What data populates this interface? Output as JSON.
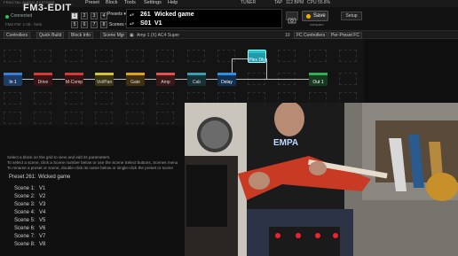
{
  "app": {
    "logo_small": "FRACTAL AUDIO SYSTEMS",
    "logo": "FM3-EDIT",
    "menu": [
      "Preset",
      "Block",
      "Tools",
      "Settings",
      "Help"
    ],
    "tuner": "TUNER",
    "tap": "TAP",
    "bpm": "112 BPM",
    "cpu": "CPU 55.8%"
  },
  "status": {
    "connected": "Connected",
    "firmware": "FM3 FW: 1.06 - beta"
  },
  "scene_buttons": [
    "1",
    "2",
    "3",
    "4",
    "5",
    "6",
    "7",
    "8"
  ],
  "preset_panel": {
    "presets_label": "Presets ▾",
    "scenes_label": "Scenes ▾",
    "preset_number": "261",
    "preset_name": "Wicked game",
    "scene_number": "S01",
    "scene_name": "V1"
  },
  "actions": {
    "save": "Save",
    "save_sub": "compare",
    "setup": "Setup"
  },
  "toolbar": {
    "controllers": "Controllers",
    "quick_build": "Quick Build",
    "block_info": "Block Info",
    "scene_mgr": "Scene Mgr",
    "block_path": "Amp 1 (X) AC4 Super",
    "count": "10",
    "fc_controllers": "FC Controllers",
    "per_preset_fc": "Per-Preset FC"
  },
  "blocks": [
    {
      "name": "In 1",
      "color": "#3b7fd4"
    },
    {
      "name": "Drive",
      "color": "#d23a3a"
    },
    {
      "name": "M-Comp",
      "color": "#d23a3a"
    },
    {
      "name": "Vol/Pan",
      "color": "#d4c238"
    },
    {
      "name": "Gate",
      "color": "#e0a020"
    },
    {
      "name": "Amp",
      "color": "#e25050"
    },
    {
      "name": "Cab",
      "color": "#3aa0b0"
    },
    {
      "name": "Delay",
      "color": "#2f8fe0"
    },
    {
      "name": "Plex Dly",
      "color": "#28c0c8"
    },
    {
      "name": "Out 1",
      "color": "#30b050"
    }
  ],
  "help": {
    "line1": "Select a block on the grid to view and edit its parameters.",
    "line2": "To select a scene, click a Scene number below or use the Scene Select buttons, Scenes menu",
    "line3": "To rename a preset or scene, double-click its name below or single-click the preset or scene"
  },
  "preset_info": {
    "label": "Preset 261:",
    "name": "Wicked game",
    "scenes": [
      {
        "label": "Scene 1:",
        "value": "V1"
      },
      {
        "label": "Scene 2:",
        "value": "V2"
      },
      {
        "label": "Scene 3:",
        "value": "V3"
      },
      {
        "label": "Scene 4:",
        "value": "V4"
      },
      {
        "label": "Scene 5:",
        "value": "V5"
      },
      {
        "label": "Scene 6:",
        "value": "V6"
      },
      {
        "label": "Scene 7:",
        "value": "V7"
      },
      {
        "label": "Scene 8:",
        "value": "V8"
      }
    ]
  }
}
